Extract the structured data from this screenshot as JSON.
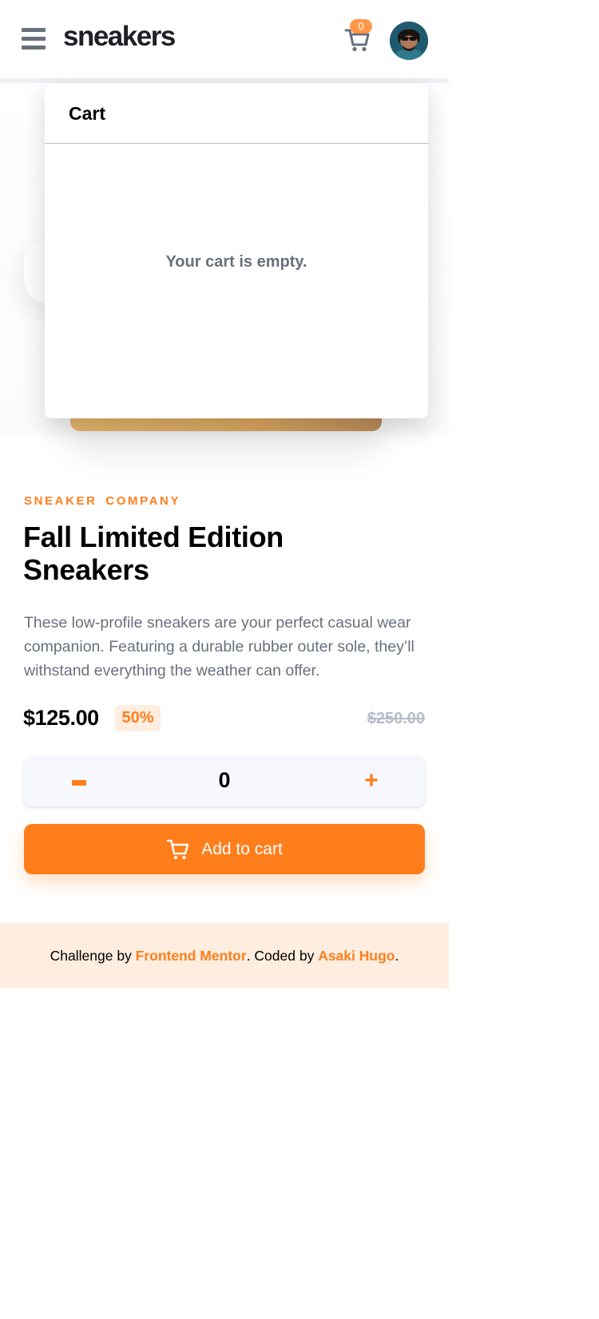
{
  "header": {
    "logo": "sneakers",
    "cart_count": "0"
  },
  "cart": {
    "title": "Cart",
    "empty_message": "Your cart is empty."
  },
  "product": {
    "company": "SNEAKER COMPANY",
    "title": "Fall Limited Edition Sneakers",
    "description": "These low-profile sneakers are your perfect casual wear companion. Featuring a durable rubber outer sole, they’ll withstand everything the weather can offer.",
    "price": "$125.00",
    "discount": "50%",
    "original_price": "$250.00"
  },
  "quantity": {
    "minus_label": "−",
    "value": "0",
    "plus_label": "+"
  },
  "add_to_cart": {
    "label": "Add to cart"
  },
  "footer": {
    "prefix": "Challenge by ",
    "challenge_link": "Frontend Mentor",
    "middle": ". Coded by ",
    "author_link": "Asaki Hugo",
    "suffix": "."
  },
  "colors": {
    "accent": "#ff7e1b",
    "accent_pale": "#ffede0",
    "dark": "#1d2026",
    "grey": "#69707d",
    "light_grey": "#b6bcc8",
    "stepper_bg": "#f6f8fd"
  },
  "icons": {
    "menu": "menu-icon",
    "cart": "cart-icon",
    "avatar": "avatar",
    "minus": "minus-icon",
    "plus": "plus-icon",
    "add_to_cart": "cart-icon"
  }
}
